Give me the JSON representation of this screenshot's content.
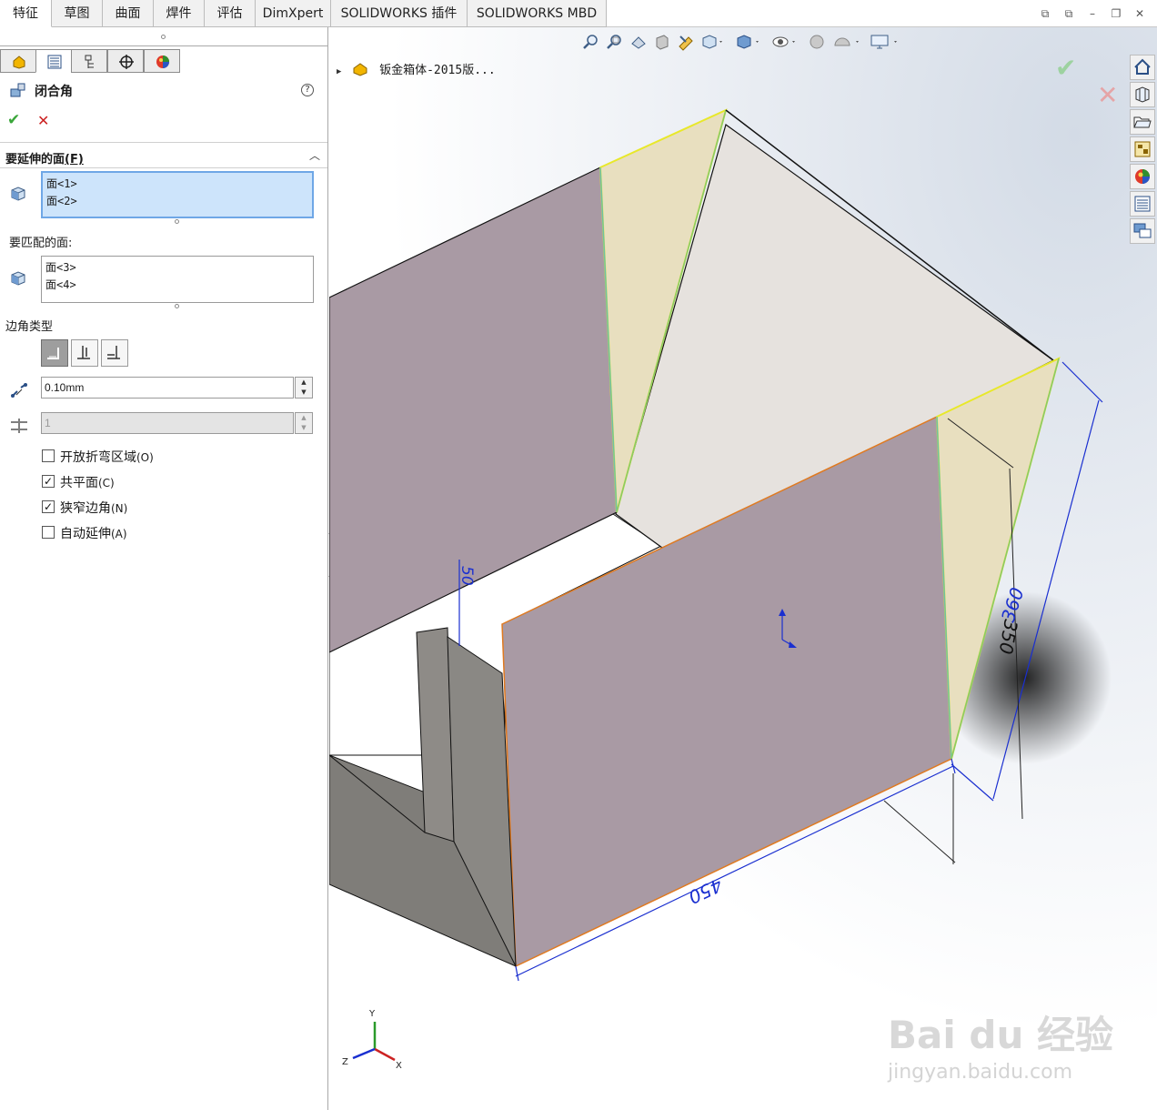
{
  "tabs": [
    "特征",
    "草图",
    "曲面",
    "焊件",
    "评估",
    "DimXpert",
    "SOLIDWORKS 插件",
    "SOLIDWORKS MBD"
  ],
  "active_tab": "特征",
  "window_controls": [
    "⧉",
    "⧉",
    "–",
    "❐",
    "✕"
  ],
  "panel": {
    "title": "闭合角",
    "help": "?",
    "confirm": "✔",
    "cancel": "✕",
    "collapse_glyph": "︿",
    "faces_to_extend": {
      "label": "要延伸的面",
      "shortcut": "(F)",
      "items": [
        "面<1>",
        "面<2>"
      ]
    },
    "faces_to_match": {
      "label": "要匹配的面:",
      "items": [
        "面<3>",
        "面<4>"
      ]
    },
    "corner_type_label": "边角类型",
    "gap_value": "0.10mm",
    "overlap_value": "1",
    "options": [
      {
        "label": "开放折弯区域",
        "key": "(O)",
        "checked": false
      },
      {
        "label": "共平面",
        "key": "(C)",
        "checked": true
      },
      {
        "label": "狭窄边角",
        "key": "(N)",
        "checked": true
      },
      {
        "label": "自动延伸",
        "key": "(A)",
        "checked": false
      }
    ]
  },
  "viewport": {
    "tree_root": "钣金箱体-2015版...",
    "dimensions": {
      "d50": "50",
      "d350": "350",
      "d360": "360",
      "d450": "450"
    },
    "triad": {
      "x": "X",
      "y": "Y",
      "z": "Z"
    },
    "watermark": {
      "logo": "Bai du 经验",
      "url": "jingyan.baidu.com"
    }
  },
  "colors": {
    "face_purple": "#a99aa4",
    "face_yellow": "#e8dfbf",
    "face_light": "#e6e2de",
    "dim_blue": "#1a2fd0",
    "accept_green": "#3aa63a",
    "cancel_red": "#cc2222"
  }
}
